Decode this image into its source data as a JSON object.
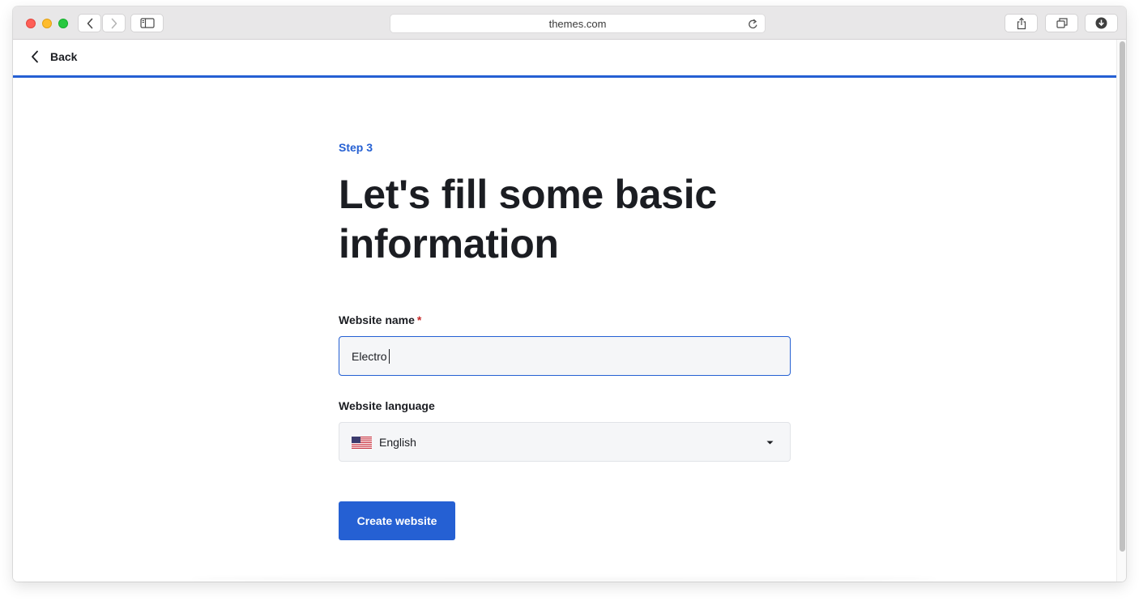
{
  "browser": {
    "url": "themes.com",
    "icons": {
      "back": "chevron-left-icon",
      "forward": "chevron-right-icon",
      "sidebar": "sidebar-icon",
      "reload": "reload-icon",
      "share": "share-icon",
      "tabs": "tabs-icon",
      "downloads": "download-icon"
    }
  },
  "nav": {
    "back_label": "Back"
  },
  "form": {
    "step_label": "Step 3",
    "title": "Let's fill some basic information",
    "website_name": {
      "label": "Website name",
      "required_marker": "*",
      "value": "Electro"
    },
    "website_language": {
      "label": "Website language",
      "selected": "English",
      "flag": "us-flag-icon"
    },
    "submit_label": "Create website"
  },
  "colors": {
    "accent": "#2560d3",
    "text": "#1b1d22",
    "required": "#c62828",
    "field_bg": "#f5f6f8"
  }
}
